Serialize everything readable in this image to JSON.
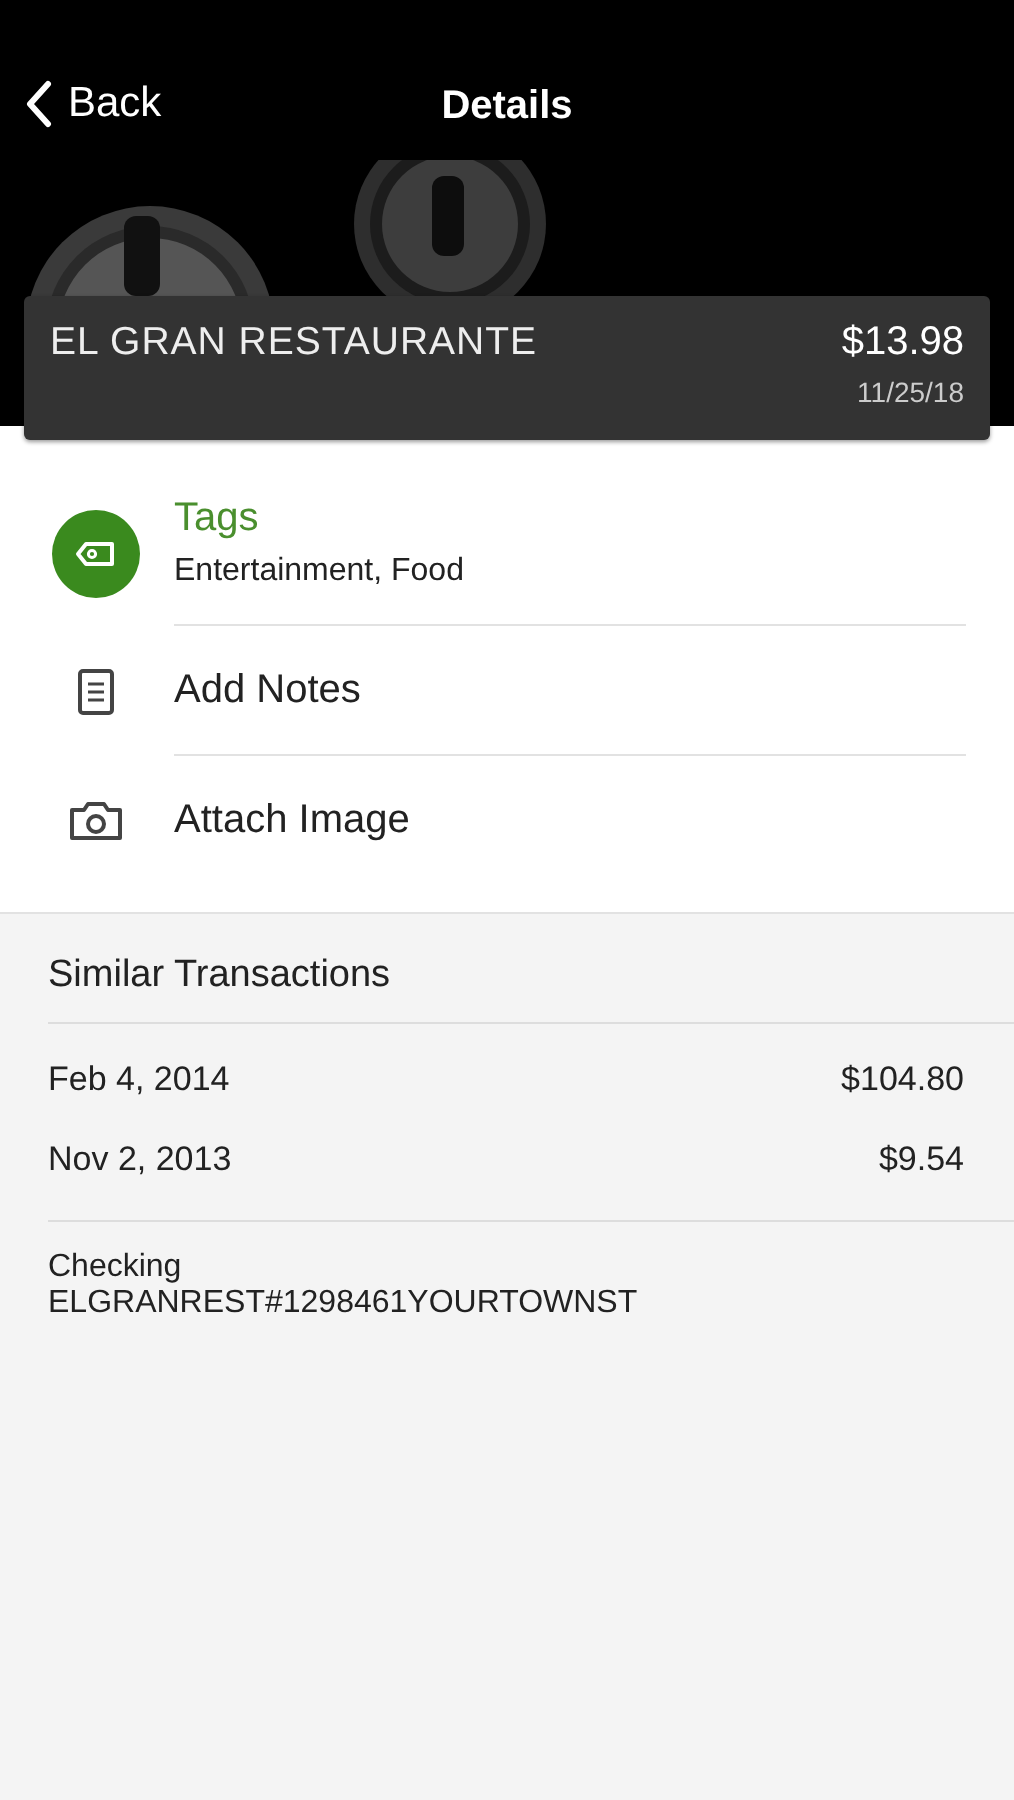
{
  "nav": {
    "back": "Back",
    "title": "Details"
  },
  "summary": {
    "merchant": "EL GRAN RESTAURANTE",
    "amount": "$13.98",
    "date": "11/25/18"
  },
  "actions": [
    {
      "kind": "tags",
      "label": "Tags",
      "detail": "Entertainment, Food"
    },
    {
      "kind": "notes",
      "label": "Add Notes"
    },
    {
      "label": "Attach Image"
    }
  ],
  "similar": {
    "title": "Similar Transactions",
    "rows": [
      {
        "date": "Feb 4, 2014",
        "amount": "$104.80"
      },
      {
        "date": "Nov 2, 2013",
        "amount": "$9.54"
      }
    ]
  },
  "account": {
    "name": "Checking",
    "description": "ELGRANREST#1298461YOURTOWNST"
  }
}
